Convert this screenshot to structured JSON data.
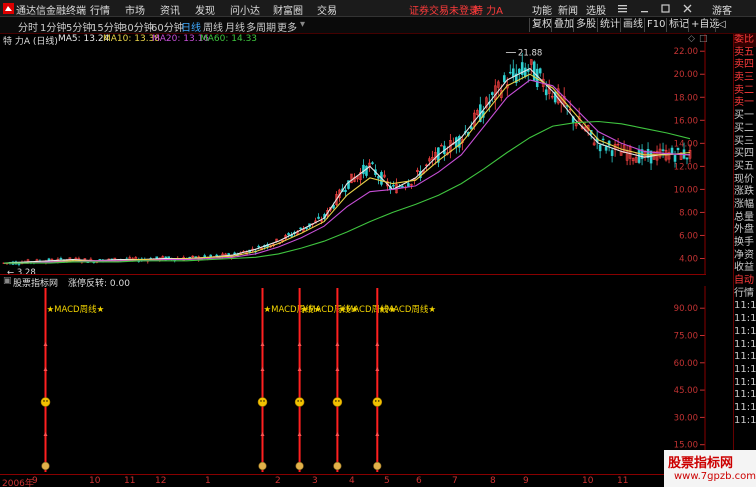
{
  "topbar": {
    "app_title": "通达信金融终端",
    "menus": [
      "行情",
      "市场",
      "资讯",
      "发现",
      "问小达",
      "财富圈",
      "交易"
    ],
    "status_warning": "证券交易未登录",
    "status_stock": "特 力A",
    "right_menus": [
      "功能",
      "新闻",
      "选股"
    ],
    "guest": "游客"
  },
  "periods": [
    "分时",
    "1分钟",
    "5分钟",
    "15分钟",
    "30分钟",
    "60分钟",
    "日线",
    "周线",
    "月线",
    "多周期",
    "更多"
  ],
  "active_period": "日线",
  "right_buttons": [
    "复权",
    "叠加",
    "多股",
    "统计",
    "画线",
    "F10",
    "标记",
    "+自选",
    "◁"
  ],
  "chart_header": {
    "stock": "特 力A (日线)",
    "ma5": "MA5: 13.24",
    "ma10": "MA10: 13.38",
    "ma20": "MA20: 13.16",
    "ma60": "MA60: 14.33"
  },
  "indicator_header": {
    "name": "股票指标网",
    "value": "涨停反转: 0.00"
  },
  "signal_label": "★MACD周线★",
  "colors": {
    "ma5": "#e8e8e8",
    "ma10": "#e8d24a",
    "ma20": "#c64fd6",
    "ma60": "#3fc43f",
    "up": "#ff4444",
    "down": "#30d0d0",
    "axis": "#c33333"
  },
  "chart_data": {
    "type": "line",
    "price_axis": {
      "ticks": [
        "22.00",
        "20.00",
        "18.00",
        "16.00",
        "14.00",
        "12.00",
        "10.00",
        "8.00",
        "6.00",
        "4.00"
      ],
      "ylim": [
        3,
        22.8
      ]
    },
    "annotations": {
      "high": "21.88",
      "low": "3.28"
    },
    "x_labels": [
      "2006年",
      "9",
      "10",
      "11",
      "12",
      "1",
      "2",
      "3",
      "4",
      "5",
      "6",
      "7",
      "8",
      "9",
      "10",
      "11"
    ],
    "series": [
      {
        "name": "MA5",
        "values": [
          3.6,
          3.7,
          3.8,
          3.9,
          3.8,
          3.9,
          3.9,
          4.0,
          4.0,
          4.1,
          4.3,
          4.8,
          5.5,
          6.5,
          7.5,
          10.5,
          12.0,
          10.0,
          11.0,
          13.0,
          14.5,
          17.0,
          19.5,
          20.5,
          18.5,
          16.0,
          14.0,
          13.3,
          12.8,
          13.1,
          13.0
        ]
      },
      {
        "name": "MA10",
        "values": [
          3.6,
          3.6,
          3.7,
          3.8,
          3.8,
          3.8,
          3.9,
          3.9,
          4.0,
          4.1,
          4.2,
          4.6,
          5.3,
          6.2,
          7.2,
          9.5,
          11.0,
          10.5,
          10.8,
          12.5,
          14.0,
          16.5,
          19.0,
          20.0,
          18.8,
          16.5,
          14.3,
          13.5,
          13.0,
          13.0,
          13.2
        ]
      },
      {
        "name": "MA20",
        "values": [
          3.6,
          3.6,
          3.7,
          3.7,
          3.8,
          3.8,
          3.8,
          3.9,
          3.9,
          4.0,
          4.1,
          4.4,
          5.0,
          5.8,
          6.8,
          8.5,
          9.8,
          10.0,
          10.3,
          11.5,
          13.0,
          15.5,
          18.0,
          19.5,
          19.0,
          17.0,
          15.0,
          14.0,
          13.3,
          13.1,
          13.0
        ]
      },
      {
        "name": "MA60",
        "values": [
          3.6,
          3.6,
          3.6,
          3.7,
          3.7,
          3.7,
          3.8,
          3.8,
          3.8,
          3.9,
          4.0,
          4.1,
          4.4,
          4.9,
          5.5,
          6.3,
          7.2,
          8.0,
          8.7,
          9.5,
          10.5,
          11.8,
          13.2,
          14.5,
          15.5,
          15.8,
          15.9,
          15.7,
          15.3,
          14.9,
          14.4
        ]
      }
    ],
    "indicator": {
      "ticks": [
        "90.00",
        "75.00",
        "60.00",
        "45.00",
        "30.00",
        "15.00"
      ],
      "ylim": [
        0,
        100
      ],
      "signal_positions": [
        0.065,
        0.375,
        0.428,
        0.482,
        0.539
      ]
    }
  },
  "right_column": [
    "委比",
    "卖五",
    "卖四",
    "卖三",
    "卖二",
    "卖一",
    "买一",
    "买二",
    "买三",
    "买四",
    "买五",
    "现价",
    "涨跌",
    "涨幅",
    "总量",
    "外盘",
    "换手",
    "净资",
    "收益",
    "自动",
    "行情",
    "11:1",
    "11:1",
    "11:1",
    "11:1",
    "11:1",
    "11:1",
    "11:1",
    "11:1",
    "11:1",
    "11:1"
  ],
  "watermark": {
    "title": "股票指标网",
    "url": "www.7gpzb.com"
  }
}
